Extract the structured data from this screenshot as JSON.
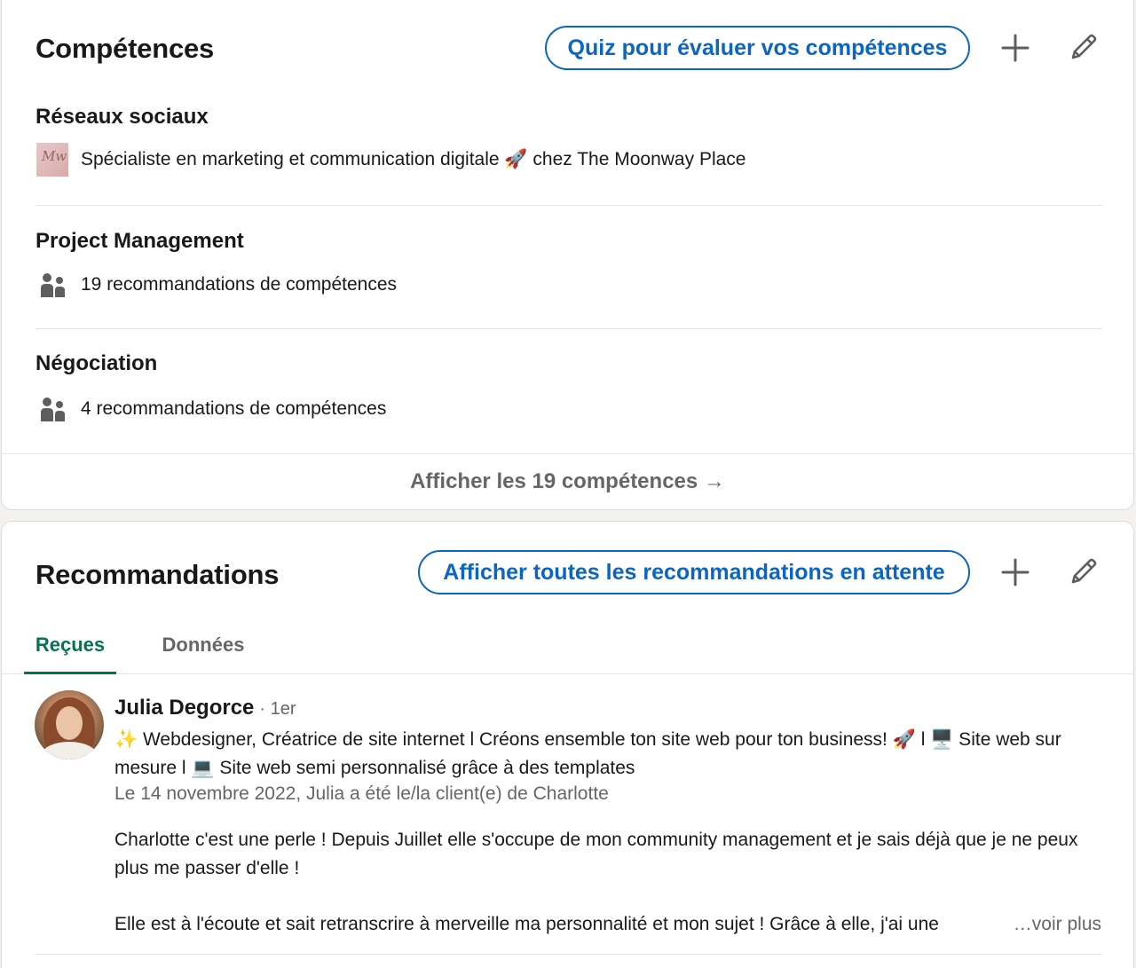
{
  "skills": {
    "title": "Compétences",
    "quiz_button": "Quiz pour évaluer vos compétences",
    "add_icon": "plus-icon",
    "edit_icon": "pencil-icon",
    "items": [
      {
        "name": "Réseaux sociaux",
        "detail_icon": "company-logo",
        "detail": "Spécialiste en marketing et communication digitale 🚀 chez The Moonway Place"
      },
      {
        "name": "Project Management",
        "detail_icon": "people-icon",
        "detail": "19 recommandations de compétences"
      },
      {
        "name": "Négociation",
        "detail_icon": "people-icon",
        "detail": "4 recommandations de compétences"
      }
    ],
    "show_all": "Afficher les 19 compétences →"
  },
  "recommendations": {
    "title": "Recommandations",
    "pending_button": "Afficher toutes les recommandations en attente",
    "add_icon": "plus-icon",
    "edit_icon": "pencil-icon",
    "tabs": [
      {
        "label": "Reçues",
        "active": true
      },
      {
        "label": "Données",
        "active": false
      }
    ],
    "items": [
      {
        "name": "Julia Degorce",
        "degree": "· 1er",
        "headline": "✨ Webdesigner, Créatrice de site internet l Créons ensemble ton site web pour ton business! 🚀 l 🖥️ Site web sur mesure l 💻 Site web semi personnalisé grâce à des templates",
        "meta": "Le 14 novembre 2022, Julia a été le/la client(e) de Charlotte",
        "paragraph_1": "Charlotte c'est une perle ! Depuis Juillet elle s'occupe de mon community management et je sais déjà que je ne peux plus me passer d'elle !",
        "paragraph_2": "Elle est à l'écoute et sait retranscrire à merveille ma personnalité et mon sujet ! Grâce à elle, j'ai une",
        "see_more": "…voir plus"
      }
    ]
  },
  "colors": {
    "accent_blue": "#0a66c2",
    "accent_green": "#01754f",
    "muted_text": "#666666",
    "page_bg": "#f4f2ee"
  }
}
